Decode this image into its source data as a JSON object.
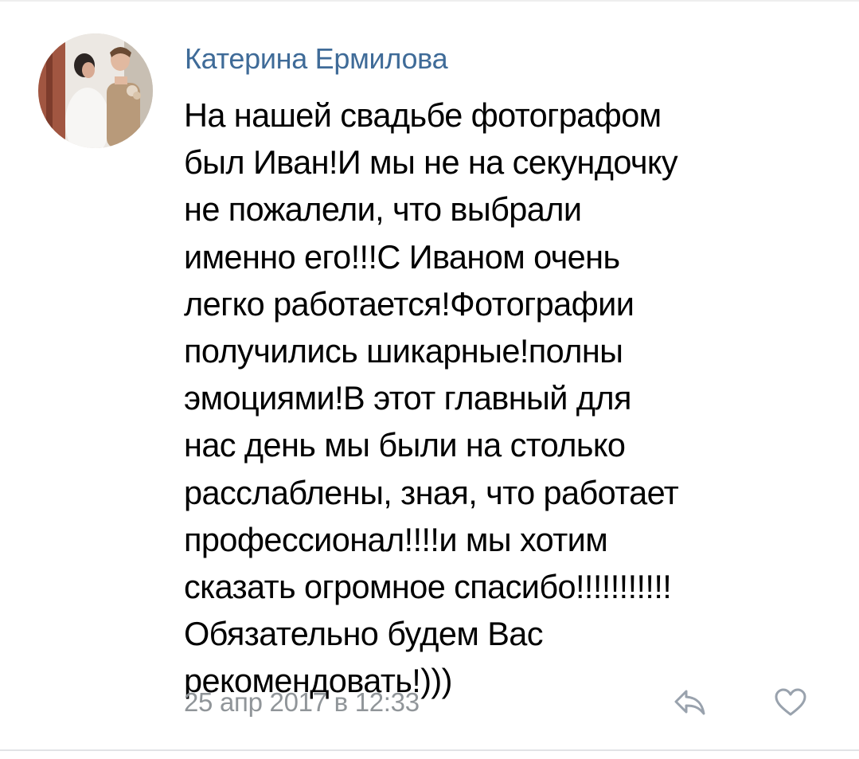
{
  "comment": {
    "author": "Катерина Ермилова",
    "text_lines": [
      "На нашей свадьбе фотографом",
      "был Иван!И мы не на секундочку",
      "не пожалели, что выбрали",
      "именно его!!!С Иваном очень",
      "легко работается!Фотографии",
      "получились шикарные!полны",
      "эмоциями!В этот главный для",
      "нас день мы были на столько",
      "расслаблены, зная, что работает",
      "профессионал!!!!и мы хотим",
      "сказать огромное спасибо!!!!!!!!!!!",
      "Обязательно будем Вас",
      "рекомендовать!)))"
    ],
    "date": "25 апр 2017 в 12:33",
    "icons": {
      "reply": "reply-icon",
      "like": "heart-icon"
    }
  },
  "colors": {
    "author": "#3f6b98",
    "meta": "#909599",
    "icon": "#99a2ad"
  }
}
